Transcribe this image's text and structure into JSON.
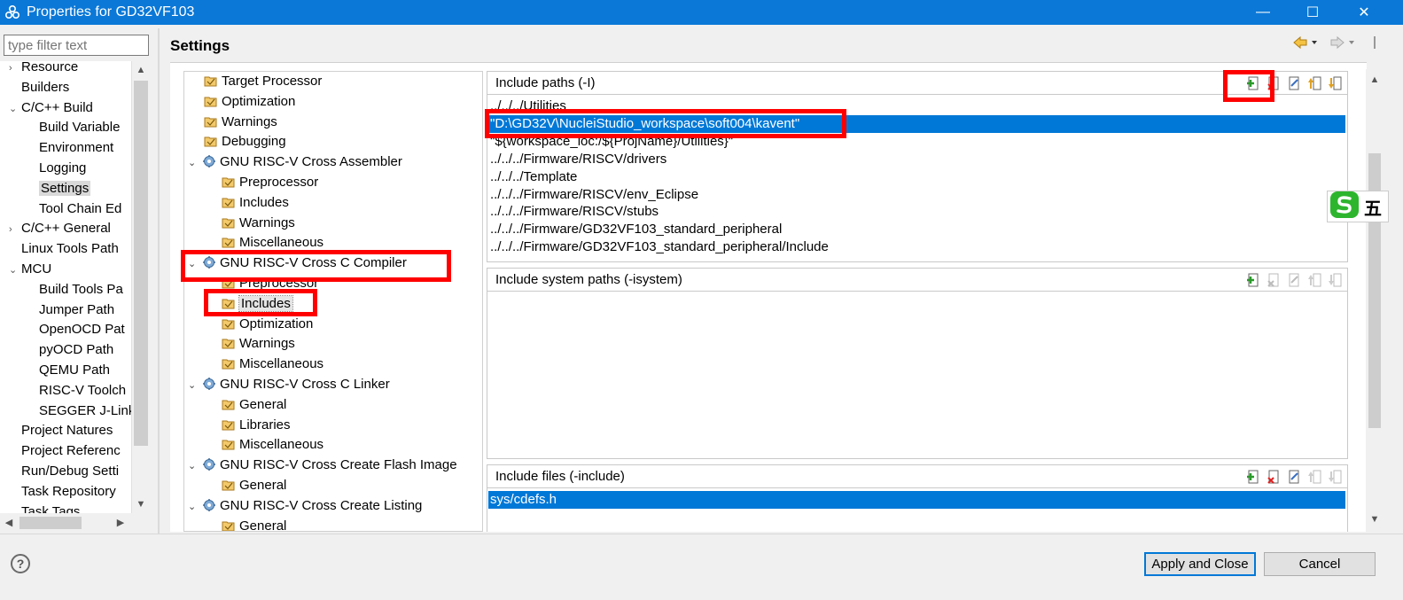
{
  "window": {
    "title": "Properties for GD32VF103",
    "minimize_glyph": "—",
    "maximize_glyph": "☐",
    "close_glyph": "✕"
  },
  "filter": {
    "placeholder": "type filter text",
    "value": ""
  },
  "nav_tree": [
    {
      "label": "Resource",
      "toggle": "›"
    },
    {
      "label": "Builders",
      "toggle": ""
    },
    {
      "label": "C/C++ Build",
      "toggle": "⌄"
    },
    {
      "label": "Build Variable",
      "toggle": ""
    },
    {
      "label": "Environment",
      "toggle": ""
    },
    {
      "label": "Logging",
      "toggle": ""
    },
    {
      "label": "Settings",
      "toggle": ""
    },
    {
      "label": "Tool Chain Ed",
      "toggle": ""
    },
    {
      "label": "C/C++ General",
      "toggle": "›"
    },
    {
      "label": "Linux Tools Path",
      "toggle": ""
    },
    {
      "label": "MCU",
      "toggle": "⌄"
    },
    {
      "label": "Build Tools Pa",
      "toggle": ""
    },
    {
      "label": "Jumper Path",
      "toggle": ""
    },
    {
      "label": "OpenOCD Pat",
      "toggle": ""
    },
    {
      "label": "pyOCD Path",
      "toggle": ""
    },
    {
      "label": "QEMU Path",
      "toggle": ""
    },
    {
      "label": "RISC-V Toolch",
      "toggle": ""
    },
    {
      "label": "SEGGER J-Link",
      "toggle": ""
    },
    {
      "label": "Project Natures",
      "toggle": ""
    },
    {
      "label": "Project Referenc",
      "toggle": ""
    },
    {
      "label": "Run/Debug Setti",
      "toggle": ""
    },
    {
      "label": "Task Repository",
      "toggle": ""
    },
    {
      "label": "Task Tags",
      "toggle": ""
    }
  ],
  "settings_title": "Settings",
  "tool_tree": [
    {
      "label": "Target Processor",
      "toggle": "",
      "icon": "folder"
    },
    {
      "label": "Optimization",
      "toggle": "",
      "icon": "folder"
    },
    {
      "label": "Warnings",
      "toggle": "",
      "icon": "folder"
    },
    {
      "label": "Debugging",
      "toggle": "",
      "icon": "folder"
    },
    {
      "label": "GNU RISC-V Cross Assembler",
      "toggle": "⌄",
      "icon": "gear"
    },
    {
      "label": "Preprocessor",
      "toggle": "",
      "icon": "folder"
    },
    {
      "label": "Includes",
      "toggle": "",
      "icon": "folder"
    },
    {
      "label": "Warnings",
      "toggle": "",
      "icon": "folder"
    },
    {
      "label": "Miscellaneous",
      "toggle": "",
      "icon": "folder"
    },
    {
      "label": "GNU RISC-V Cross C Compiler",
      "toggle": "⌄",
      "icon": "gear"
    },
    {
      "label": "Preprocessor",
      "toggle": "",
      "icon": "folder"
    },
    {
      "label": "Includes",
      "toggle": "",
      "icon": "folder"
    },
    {
      "label": "Optimization",
      "toggle": "",
      "icon": "folder"
    },
    {
      "label": "Warnings",
      "toggle": "",
      "icon": "folder"
    },
    {
      "label": "Miscellaneous",
      "toggle": "",
      "icon": "folder"
    },
    {
      "label": "GNU RISC-V Cross C Linker",
      "toggle": "⌄",
      "icon": "gear"
    },
    {
      "label": "General",
      "toggle": "",
      "icon": "folder"
    },
    {
      "label": "Libraries",
      "toggle": "",
      "icon": "folder"
    },
    {
      "label": "Miscellaneous",
      "toggle": "",
      "icon": "folder"
    },
    {
      "label": "GNU RISC-V Cross Create Flash Image",
      "toggle": "⌄",
      "icon": "gear"
    },
    {
      "label": "General",
      "toggle": "",
      "icon": "folder"
    },
    {
      "label": "GNU RISC-V Cross Create Listing",
      "toggle": "⌄",
      "icon": "gear"
    },
    {
      "label": "General",
      "toggle": "",
      "icon": "folder"
    }
  ],
  "include_paths": {
    "title": "Include paths (-I)",
    "items": [
      "../../../Utilities",
      "\"D:\\GD32V\\NucleiStudio_workspace\\soft004\\kavent\"",
      "\"${workspace_loc:/${ProjName}/Utilities}\"",
      "../../../Firmware/RISCV/drivers",
      "../../../Template",
      "../../../Firmware/RISCV/env_Eclipse",
      "../../../Firmware/RISCV/stubs",
      "../../../Firmware/GD32VF103_standard_peripheral",
      "../../../Firmware/GD32VF103_standard_peripheral/Include"
    ]
  },
  "system_paths": {
    "title": "Include system paths (-isystem)"
  },
  "include_files": {
    "title": "Include files (-include)",
    "items": [
      "sys/cdefs.h"
    ]
  },
  "buttons": {
    "apply_close": "Apply and Close",
    "cancel": "Cancel",
    "help": "?"
  },
  "ime": {
    "label": "五"
  },
  "colors": {
    "titlebar": "#0b78d7",
    "selection": "#0078d7",
    "highlight": "#ff0000"
  }
}
